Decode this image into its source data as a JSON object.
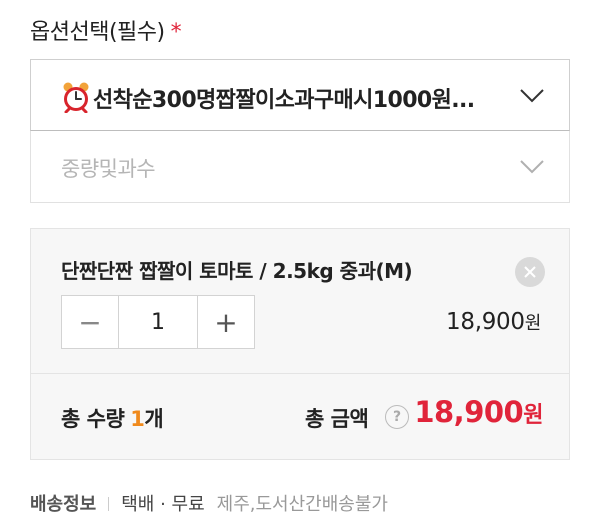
{
  "option_section": {
    "title": "옵션선택(필수)",
    "required_mark": "*"
  },
  "select_primary": {
    "icon": "alarm-clock-icon",
    "value": "선착순300명짭짤이소과구매시1000원..."
  },
  "select_secondary": {
    "placeholder": "중량및과수"
  },
  "selected_item": {
    "name": "단짠단짠 짭짤이 토마토 / 2.5kg 중과(M)",
    "quantity": "1",
    "minus_label": "−",
    "plus_label": "+",
    "price": "18,900",
    "price_unit": "원"
  },
  "summary": {
    "qty_label": "총 수량",
    "qty_value": "1",
    "qty_unit": "개",
    "amount_label": "총 금액",
    "help_label": "?",
    "amount_value": "18,900",
    "amount_unit": "원"
  },
  "shipping": {
    "title": "배송정보",
    "method": "택배 · 무료",
    "note": "제주,도서산간배송불가"
  },
  "colors": {
    "accent_red": "#e0243a",
    "accent_orange": "#f08a1c"
  }
}
